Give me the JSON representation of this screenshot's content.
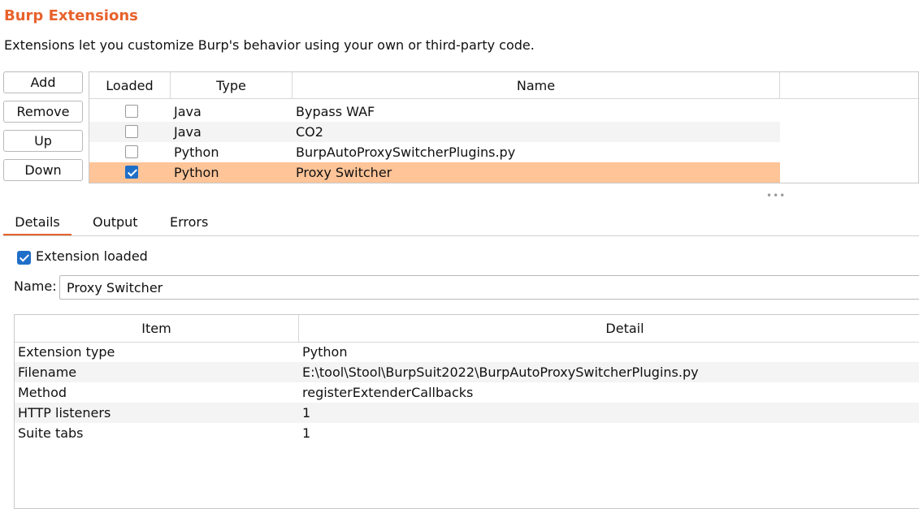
{
  "header": {
    "title": "Burp Extensions",
    "description": "Extensions let you customize Burp's behavior using your own or third-party code."
  },
  "buttons": {
    "add": "Add",
    "remove": "Remove",
    "up": "Up",
    "down": "Down"
  },
  "extensions_table": {
    "columns": [
      "Loaded",
      "Type",
      "Name"
    ],
    "rows": [
      {
        "loaded": false,
        "type": "Java",
        "name": "Bypass WAF"
      },
      {
        "loaded": false,
        "type": "Java",
        "name": "CO2"
      },
      {
        "loaded": false,
        "type": "Python",
        "name": "BurpAutoProxySwitcherPlugins.py"
      },
      {
        "loaded": true,
        "type": "Python",
        "name": "Proxy Switcher"
      }
    ],
    "selected_row": 3
  },
  "tabs": [
    "Details",
    "Output",
    "Errors"
  ],
  "active_tab": "Details",
  "details": {
    "extension_loaded_label": "Extension loaded",
    "extension_loaded": true,
    "name_label": "Name:",
    "name_value": "Proxy Switcher",
    "table": {
      "columns": [
        "Item",
        "Detail"
      ],
      "rows": [
        {
          "item": "Extension type",
          "detail": "Python"
        },
        {
          "item": "Filename",
          "detail": "E:\\tool\\Stool\\BurpSuit2022\\BurpAutoProxySwitcherPlugins.py"
        },
        {
          "item": "Method",
          "detail": "registerExtenderCallbacks"
        },
        {
          "item": "HTTP listeners",
          "detail": "1"
        },
        {
          "item": "Suite tabs",
          "detail": "1"
        }
      ]
    }
  },
  "divider_grip": "•••",
  "colors": {
    "accent": "#e8622c",
    "selection": "#ffc497",
    "checkbox": "#1f6fc8"
  }
}
